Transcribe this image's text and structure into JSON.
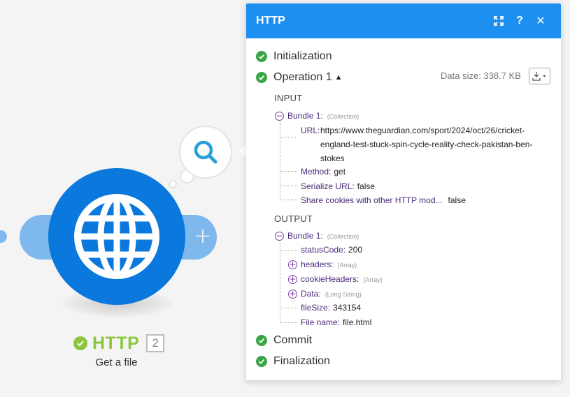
{
  "module": {
    "name": "HTTP",
    "id": "2",
    "subtitle": "Get a file"
  },
  "panel": {
    "title": "HTTP",
    "phases": {
      "initialization": "Initialization",
      "operation": "Operation 1",
      "commit": "Commit",
      "finalization": "Finalization"
    },
    "data_size": "Data size: 338.7 KB",
    "input": {
      "section_label": "INPUT",
      "bundle_label": "Bundle 1:",
      "bundle_type": "(Collection)",
      "url_key": "URL:",
      "url_value": "https://www.theguardian.com/sport/2024/oct/26/cricket-england-test-stuck-spin-cycle-reality-check-pakistan-ben-stokes",
      "method_key": "Method:",
      "method_value": "get",
      "serialize_key": "Serialize URL:",
      "serialize_value": "false",
      "cookies_key": "Share cookies with other HTTP mod...",
      "cookies_value": "false"
    },
    "output": {
      "section_label": "OUTPUT",
      "bundle_label": "Bundle 1:",
      "bundle_type": "(Collection)",
      "status_key": "statusCode:",
      "status_value": "200",
      "headers_key": "headers:",
      "headers_type": "(Array)",
      "cookie_headers_key": "cookieHeaders:",
      "cookie_headers_type": "(Array)",
      "data_key": "Data:",
      "data_type": "(Long String)",
      "filesize_key": "fileSize:",
      "filesize_value": "343154",
      "filename_key": "File name:",
      "filename_value": "file.html"
    }
  },
  "colors": {
    "module_blue": "#0a78dc",
    "connector_blue": "#7fb8ec",
    "header_blue": "#1d8ff0",
    "success_green": "#3aa545",
    "module_name_green": "#8cc63f"
  },
  "icons": {
    "module": "globe-icon",
    "bubble": "magnifier-icon",
    "expand": "expand-icon",
    "help": "help-icon",
    "close": "close-icon",
    "download": "download-icon"
  }
}
